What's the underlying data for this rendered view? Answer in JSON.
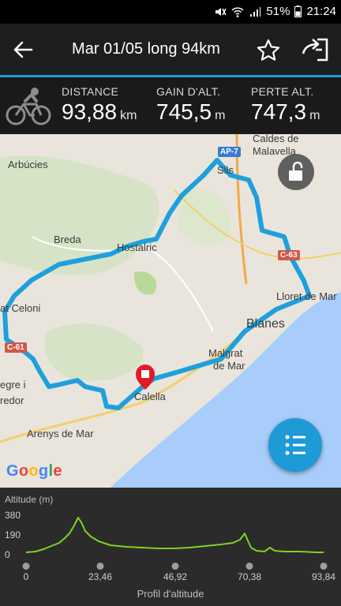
{
  "status_bar": {
    "battery": "51%",
    "time": "21:24"
  },
  "header": {
    "title": "Mar 01/05 long 94km"
  },
  "stats": [
    {
      "label": "DISTANCE",
      "value": "93,88",
      "unit": "km"
    },
    {
      "label": "GAIN D'ALT.",
      "value": "745,5",
      "unit": "m"
    },
    {
      "label": "PERTE ALT.",
      "value": "747,3",
      "unit": "m"
    }
  ],
  "map": {
    "places": {
      "caldes": "Caldes de",
      "malavella": "Malavella",
      "arbucies": "Arbúcies",
      "sils": "Sils",
      "breda": "Breda",
      "hostalric": "Hostalric",
      "celoni": "at Celoni",
      "lloret": "Lloret de Mar",
      "blanes": "Blanes",
      "malgrat": "Malgrat",
      "de_mar": "de Mar",
      "calella": "Calella",
      "egre": "egre i",
      "redor": "redor",
      "arenys": "Arenys de Mar"
    },
    "roads": {
      "ap7": "AP-7",
      "c63": "C-63",
      "c61": "C-61"
    },
    "attribution": "Google",
    "colors": {
      "route": "#1ea0dc",
      "water": "#a9cdfa",
      "land": "#e9e5dc",
      "marker": "#e01b24"
    }
  },
  "profile": {
    "title": "Altitude (m)",
    "y_labels": [
      "380",
      "190",
      "0"
    ],
    "x_labels": [
      "0",
      "23,46",
      "46,92",
      "70,38",
      "93,84"
    ],
    "footer": "Profil d'altitude",
    "line_color": "#7ed321"
  }
}
